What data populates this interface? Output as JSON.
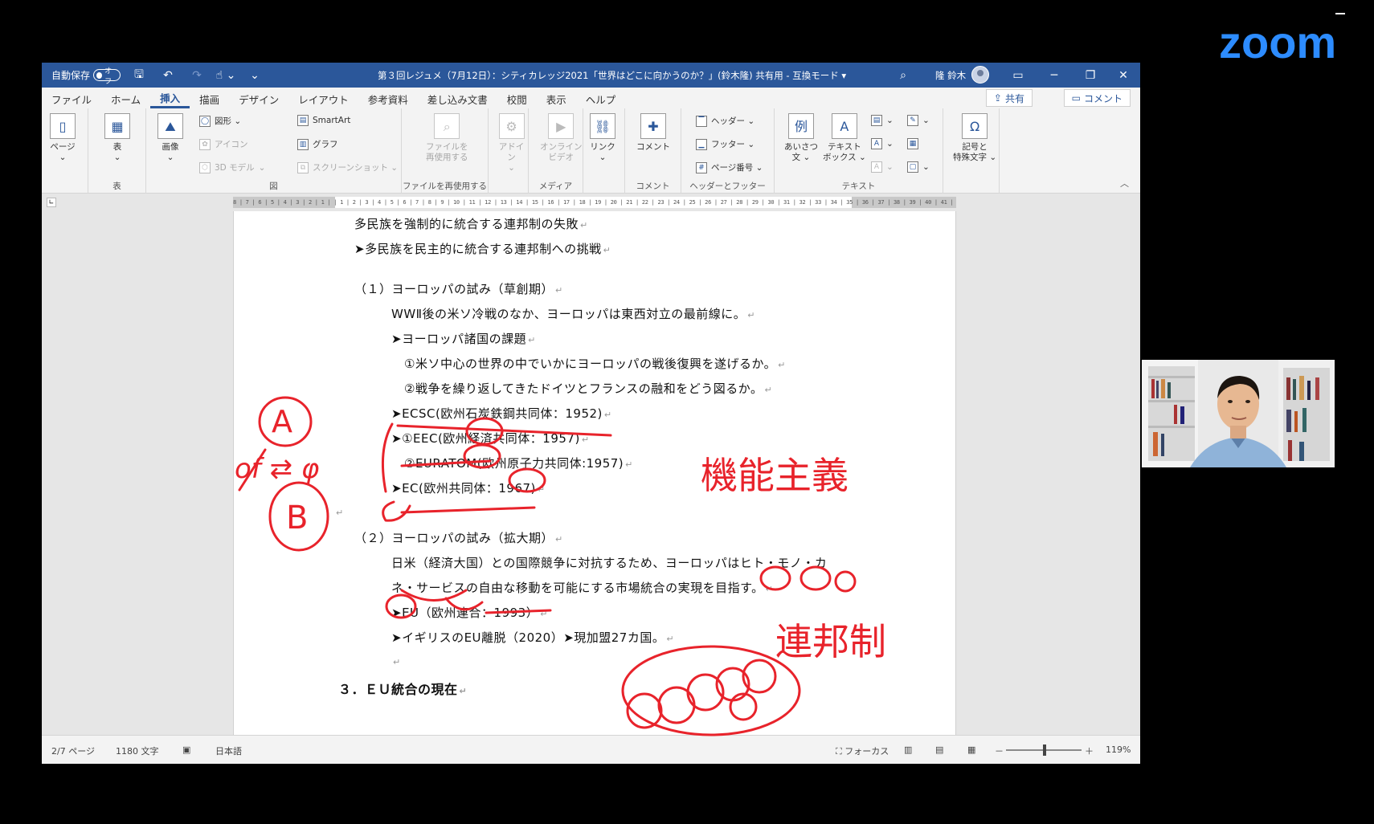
{
  "zoom": {
    "logo_text": "zoom"
  },
  "titlebar": {
    "autosave_label": "自動保存",
    "autosave_state": "オフ",
    "doc_title": "第３回レジュメ（7月12日）：シティカレッジ2021「世界はどこに向かうのか？」(鈴木隆) 共有用 - 互換モード ▾",
    "user_name": "隆 鈴木",
    "save_icon": "save-icon",
    "undo_icon": "undo-icon",
    "redo_icon": "redo-icon",
    "touch_icon": "touch-mode-icon"
  },
  "tabs": [
    "ファイル",
    "ホーム",
    "挿入",
    "描画",
    "デザイン",
    "レイアウト",
    "参考資料",
    "差し込み文書",
    "校閲",
    "表示",
    "ヘルプ"
  ],
  "active_tab": "挿入",
  "share_label": "共有",
  "comment_label": "コメント",
  "ribbon": {
    "page_btn": "ページ",
    "table_btn": "表",
    "group_table": "表",
    "image_btn": "画像",
    "shapes_btn": "図形 ⌄",
    "icons_btn": "アイコン",
    "model3d_btn": "3D モデル",
    "smartart_btn": "SmartArt",
    "chart_btn": "グラフ",
    "screenshot_btn": "スクリーンショット ⌄",
    "group_figure": "図",
    "reuse_btn_1": "ファイルを",
    "reuse_btn_2": "再使用する",
    "group_reuse": "ファイルを再使用する",
    "addin_btn": "アドイン",
    "online_video_1": "オンライン",
    "online_video_2": "ビデオ",
    "group_media": "メディア",
    "link_btn": "リンク",
    "comment_btn": "コメント",
    "group_comment": "コメント",
    "header_btn": "ヘッダー ⌄",
    "footer_btn": "フッター ⌄",
    "page_number_btn": "ページ番号 ⌄",
    "group_header_footer": "ヘッダーとフッター",
    "greeting_1": "あいさつ",
    "greeting_2": "文 ⌄",
    "textbox_1": "テキスト",
    "textbox_2": "ボックス ⌄",
    "group_text": "テキスト",
    "symbol_1": "記号と",
    "symbol_2": "特殊文字 ⌄"
  },
  "ruler_text": "8 | 7 | 6 | 5 | 4 | 3 | 2 | 1 |   | 1 | 2 | 3 | 4 | 5 | 6 | 7 | 8 | 9 | 10 | 11 | 12 | 13 | 14 | 15 | 16 | 17 | 18 | 19 | 20 | 21 | 22 | 23 | 24 | 25 | 26 | 27 | 28 | 29 | 30 | 31 | 32 | 33 | 34 | 35 | 36 | 37 | 38 | 39 | 40 | 41 | 42 | 43 | 44 | 45 | 46 | 47 | 48 |",
  "document": {
    "lines": [
      "多民族を強制的に統合する連邦制の失敗",
      "➤多民族を民主的に統合する連邦制への挑戦",
      "（１）ヨーロッパの試み（草創期）",
      "WWⅡ後の米ソ冷戦のなか、ヨーロッパは東西対立の最前線に。",
      "➤ヨーロッパ諸国の課題",
      "①米ソ中心の世界の中でいかにヨーロッパの戦後復興を遂げるか。",
      "②戦争を繰り返してきたドイツとフランスの融和をどう図るか。",
      "➤ECSC(欧州石炭鉄鋼共同体：1952)",
      "➤①EEC(欧州経済共同体：1957)",
      "②EURATOM(欧州原子力共同体:1957)",
      "➤EC(欧州共同体：1967)",
      "",
      "（２）ヨーロッパの試み（拡大期）",
      "日米（経済大国）との国際競争に対抗するため、ヨーロッパはヒト・モノ・カ",
      "ネ・サービスの自由な移動を可能にする市場統合の実現を目指す。",
      "➤EU（欧州連合：1993）",
      "➤イギリスのEU離脱（2020）➤現加盟27カ国。",
      "",
      "３．ＥＵ統合の現在"
    ],
    "paragraph_mark": "↵"
  },
  "annotations": {
    "circle_a": "A",
    "circle_b": "B",
    "side_note": "of ⇄ φ",
    "functionalism": "機能主義",
    "federalism": "連邦制"
  },
  "statusbar": {
    "page": "2/7 ページ",
    "word_count": "1180 文字",
    "language": "日本語",
    "focus": "フォーカス",
    "zoom_minus": "－",
    "zoom_plus": "＋",
    "zoom_level": "119%"
  },
  "colors": {
    "word_blue": "#2b579a",
    "ink_red": "#e8232b",
    "zoom_blue": "#2d8cff"
  }
}
